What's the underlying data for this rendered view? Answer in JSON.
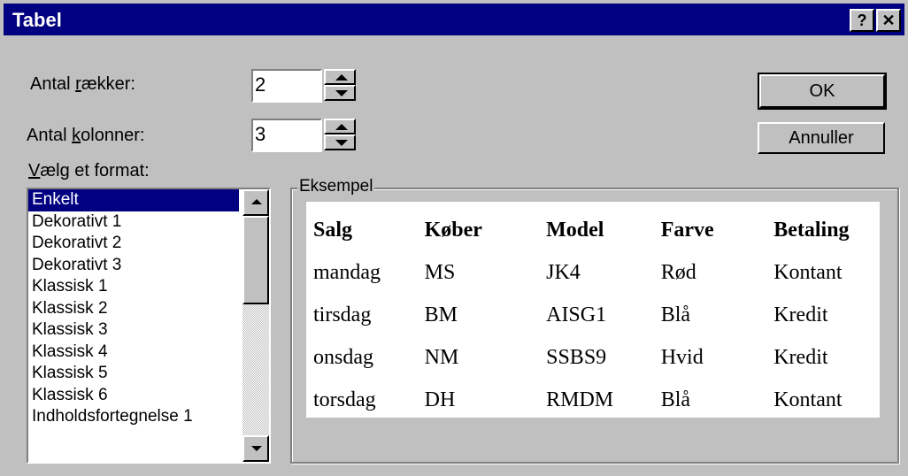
{
  "window": {
    "title": "Tabel",
    "help_button": "?",
    "close_button": "✕"
  },
  "fields": {
    "rows": {
      "label_pre": "Antal ",
      "label_accel": "r",
      "label_post": "ækker:",
      "value": "2"
    },
    "columns": {
      "label_pre": "Antal ",
      "label_accel": "k",
      "label_post": "olonner:",
      "value": "3"
    }
  },
  "buttons": {
    "ok": "OK",
    "cancel": "Annuller"
  },
  "format_list": {
    "label_accel": "V",
    "label_post": "ælg et format:",
    "items": [
      "Enkelt",
      "Dekorativt 1",
      "Dekorativt 2",
      "Dekorativt 3",
      "Klassisk 1",
      "Klassisk 2",
      "Klassisk 3",
      "Klassisk 4",
      "Klassisk 5",
      "Klassisk 6",
      "Indholdsfortegnelse 1"
    ],
    "selected_index": 0
  },
  "example": {
    "legend": "Eksempel",
    "header": [
      "Salg",
      "Køber",
      "Model",
      "Farve",
      "Betaling"
    ],
    "rows": [
      [
        "mandag",
        "MS",
        "JK4",
        "Rød",
        "Kontant"
      ],
      [
        "tirsdag",
        "BM",
        "AISG1",
        "Blå",
        "Kredit"
      ],
      [
        "onsdag",
        "NM",
        "SSBS9",
        "Hvid",
        "Kredit"
      ],
      [
        "torsdag",
        "DH",
        "RMDM",
        "Blå",
        "Kontant"
      ]
    ]
  },
  "colors": {
    "titlebar": "#000080",
    "selection": "#000080",
    "face": "#c0c0c0"
  }
}
